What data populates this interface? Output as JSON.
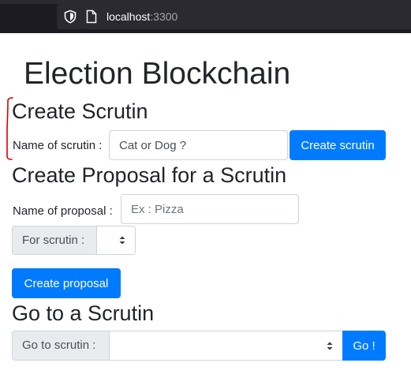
{
  "browser": {
    "url_host": "localhost",
    "url_port": ":3300"
  },
  "page": {
    "title": "Election Blockchain"
  },
  "create_scrutin": {
    "heading": "Create Scrutin",
    "label": "Name of scrutin :",
    "input_value": "Cat or Dog ?",
    "button_label": "Create scrutin"
  },
  "create_proposal": {
    "heading": "Create Proposal for a Scrutin",
    "label": "Name of proposal :",
    "placeholder": "Ex : Pizza",
    "for_scrutin_label": "For scrutin :",
    "for_scrutin_selected": "",
    "button_label": "Create proposal"
  },
  "go_to_scrutin": {
    "heading": "Go to a Scrutin",
    "label": "Go to scrutin :",
    "selected": "",
    "button_label": "Go !"
  },
  "colors": {
    "primary": "#007bff",
    "addon_bg": "#e9ecef",
    "border": "#ced4da",
    "annotation": "#d90000"
  }
}
